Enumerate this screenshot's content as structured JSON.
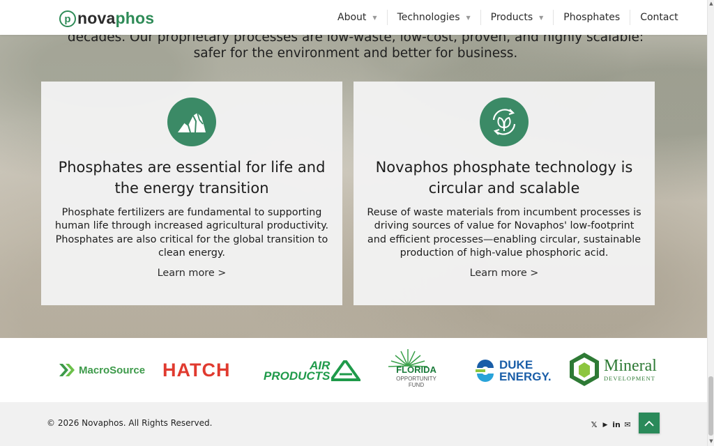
{
  "brand": {
    "logo_part1": "nova",
    "logo_part2": "phos",
    "logo_mark": "p",
    "green": "#2e8b57"
  },
  "nav": {
    "items": [
      {
        "label": "About",
        "has_dropdown": true
      },
      {
        "label": "Technologies",
        "has_dropdown": true
      },
      {
        "label": "Products",
        "has_dropdown": true
      },
      {
        "label": "Phosphates",
        "has_dropdown": false
      },
      {
        "label": "Contact",
        "has_dropdown": false
      }
    ]
  },
  "hero": {
    "text_line1": "decades. Our proprietary processes are low-waste, low-cost, proven, and highly scalable:",
    "text_line2": "safer for the environment and better for business."
  },
  "cards": [
    {
      "icon": "mountain-icon",
      "title": "Phosphates are essential for life and the energy transition",
      "body": "Phosphate fertilizers are fundamental to supporting human life through increased agricultural productivity. Phosphates are also critical for the global transition to clean energy.",
      "link": "Learn more >"
    },
    {
      "icon": "recycle-leaf-icon",
      "title": "Novaphos phosphate technology is circular and scalable",
      "body": "Reuse of waste materials from incumbent processes is driving sources of value for Novaphos' low-footprint and efficient processes—enabling circular, sustainable production of high-value phosphoric acid.",
      "link": "Learn more >"
    }
  ],
  "partners": {
    "macrosource": "MacroSource",
    "hatch": "HATCH",
    "air_products_1": "AIR",
    "air_products_2": "PRODUCTS",
    "florida_1": "FLORIDA",
    "florida_2": "OPPORTUNITY",
    "florida_3": "FUND",
    "duke_1": "DUKE",
    "duke_2": "ENERGY.",
    "mineral_1": "Mineral",
    "mineral_2": "DEVELOPMENT"
  },
  "footer": {
    "copyright": "© 2026 Novaphos. All Rights Reserved.",
    "social": [
      "x-icon",
      "youtube-icon",
      "linkedin-icon",
      "email-icon"
    ]
  }
}
